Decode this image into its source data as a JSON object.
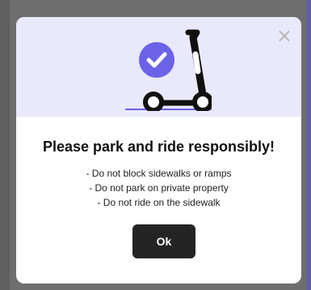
{
  "modal": {
    "close_label": "×",
    "title": "Please park and ride responsibly!",
    "rules": [
      "- Do not block sidewalks or ramps",
      "- Do not park on private property",
      "- Do not ride on the sidewalk"
    ],
    "ok_label": "Ok"
  },
  "icons": {
    "close": "close-icon",
    "check": "check-circle-icon",
    "scooter": "scooter-illustration"
  },
  "colors": {
    "backdrop": "#6e6e6e",
    "hero": "#e9e9fb",
    "accent": "#6b62e8",
    "button": "#242424"
  }
}
